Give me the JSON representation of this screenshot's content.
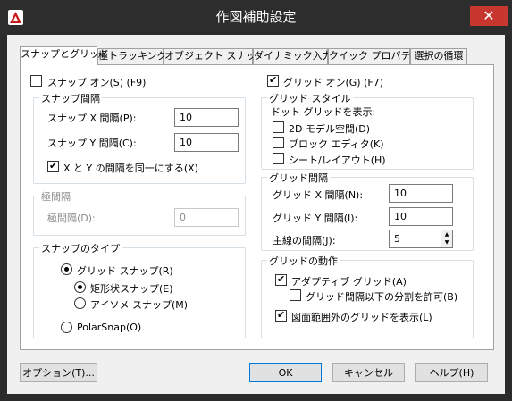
{
  "window": {
    "title": "作図補助設定",
    "close_glyph": "✕"
  },
  "tabs": [
    {
      "label": "スナップとグリッド"
    },
    {
      "label": "極トラッキング"
    },
    {
      "label": "オブジェクト スナップ"
    },
    {
      "label": "ダイナミック入力"
    },
    {
      "label": "クイック プロパティ"
    },
    {
      "label": "選択の循環"
    }
  ],
  "snap": {
    "on_label": "スナップ オン(S) (F9)",
    "on_checked": false,
    "spacing_group": "スナップ間隔",
    "x_label": "スナップ X 間隔(P):",
    "x_value": "10",
    "y_label": "スナップ Y 間隔(C):",
    "y_value": "10",
    "equal_label": "X と Y の間隔を同一にする(X)",
    "equal_checked": true
  },
  "polar": {
    "group": "極間隔",
    "distance_label": "極間隔(D):",
    "distance_value": "0"
  },
  "snap_type": {
    "group": "スナップのタイプ",
    "grid_snap_label": "グリッド スナップ(R)",
    "rect_label": "矩形状スナップ(E)",
    "iso_label": "アイソメ スナップ(M)",
    "polar_label": "PolarSnap(O)"
  },
  "grid": {
    "on_label": "グリッド オン(G) (F7)",
    "on_checked": true,
    "style_group": "グリッド スタイル",
    "dot_label": "ドット グリッドを表示:",
    "model_label": "2D モデル空間(D)",
    "block_label": "ブロック エディタ(K)",
    "sheet_label": "シート/レイアウト(H)",
    "spacing_group": "グリッド間隔",
    "x_label": "グリッド X 間隔(N):",
    "x_value": "10",
    "y_label": "グリッド Y 間隔(I):",
    "y_value": "10",
    "major_label": "主線の間隔(J):",
    "major_value": "5",
    "behavior_group": "グリッドの動作",
    "adaptive_label": "アダプティブ グリッド(A)",
    "subdivide_label": "グリッド間隔以下の分割を許可(B)",
    "beyond_label": "図面範囲外のグリッドを表示(L)"
  },
  "buttons": {
    "options": "オプション(T)...",
    "ok": "OK",
    "cancel": "キャンセル",
    "help": "ヘルプ(H)"
  },
  "colors": {
    "accent": "#0078d7",
    "close": "#c7372f",
    "titlebar": "#2d2d2d",
    "brand": "#c71a1a"
  }
}
